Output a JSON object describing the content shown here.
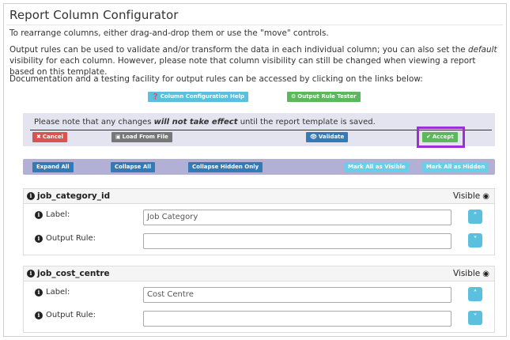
{
  "page": {
    "title": "Report Column Configurator",
    "intro": "To rearrange columns, either drag-and-drop them or use the \"move\" controls.",
    "output_rules_pre": "Output rules can be used to validate and/or transform the data in each individual column; you can also set the ",
    "output_rules_em": "default",
    "output_rules_post": " visibility for each column. However, please note that column visibility can still be changed when viewing a report based on this template.",
    "docs": "Documentation and a testing facility for output rules can be accessed by clicking on the links below:"
  },
  "help_buttons": {
    "column_help": "Column Configuration Help",
    "rule_tester": "Output Rule Tester"
  },
  "notice": {
    "pre": "Please note that any changes ",
    "em": "will not take effect",
    "post": " until the report template is saved."
  },
  "actions": {
    "cancel": "Cancel",
    "load": "Load From File",
    "validate": "Validate",
    "accept": "Accept"
  },
  "toolbar": {
    "expand_all": "Expand All",
    "collapse_all": "Collapse All",
    "collapse_hidden": "Collapse Hidden Only",
    "mark_visible": "Mark All as Visible",
    "mark_hidden": "Mark All as Hidden"
  },
  "columns": [
    {
      "name": "job_category_id",
      "visibility": "Visible",
      "label_caption": "Label:",
      "label_value": "Job Category",
      "rule_caption": "Output Rule:",
      "rule_value": ""
    },
    {
      "name": "job_cost_centre",
      "visibility": "Visible",
      "label_caption": "Label:",
      "label_value": "Cost Centre",
      "rule_caption": "Output Rule:",
      "rule_value": ""
    }
  ],
  "icons": {
    "up": "double-chevron-up-icon",
    "down": "double-chevron-down-icon",
    "eye": "eye-icon",
    "info": "info-circle-icon"
  },
  "colors": {
    "info": "#5bc0de",
    "success": "#5cb85c",
    "danger": "#d9534f",
    "default": "#777777",
    "primary": "#337ab7",
    "highlight": "#9b30d9"
  }
}
